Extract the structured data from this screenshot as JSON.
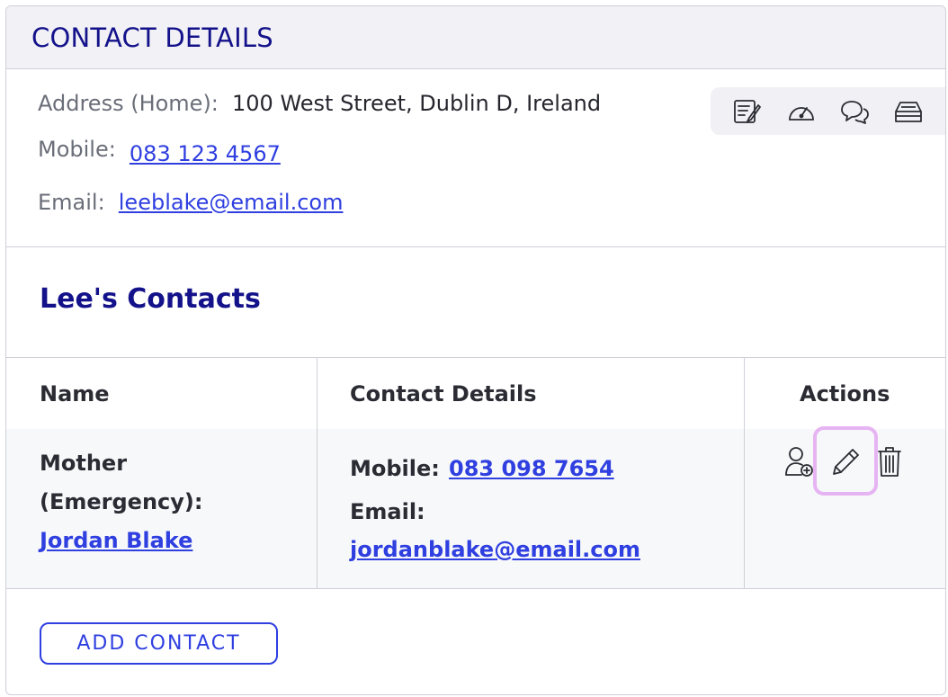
{
  "header": {
    "title": "CONTACT DETAILS"
  },
  "details": {
    "address_label": "Address (Home):",
    "address_value": "100 West Street, Dublin D, Ireland",
    "mobile_label": "Mobile:",
    "mobile_value": "083 123 4567",
    "email_label": "Email:",
    "email_value": "leeblake@email.com"
  },
  "toolbar": {
    "icons": [
      "notes-icon",
      "dashboard-gauge-icon",
      "chat-bubbles-icon",
      "inbox-tray-icon"
    ]
  },
  "contacts": {
    "title": "Lee's Contacts",
    "columns": [
      "Name",
      "Contact Details",
      "Actions"
    ],
    "rows": [
      {
        "relation_line1": "Mother",
        "relation_line2": "(Emergency):",
        "name": "Jordan Blake",
        "mobile_label": "Mobile:",
        "mobile_value": "083 098 7654",
        "email_label": "Email:",
        "email_value": "jordanblake@email.com"
      }
    ],
    "add_button": "ADD CONTACT"
  },
  "colors": {
    "title_navy": "#14128a",
    "link_blue": "#2f3fe0",
    "focus_outline": "#e6b4f2",
    "border": "#cfd0d8"
  }
}
